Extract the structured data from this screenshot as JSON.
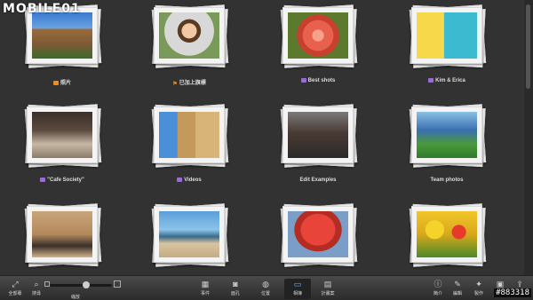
{
  "logo": "MOBILE01",
  "albums": [
    {
      "label": "照片",
      "icon": "photos-icon",
      "icon_color": "orange"
    },
    {
      "label": "已加上旗標",
      "icon": "flag-icon",
      "icon_color": "flag"
    },
    {
      "label": "Best shots",
      "icon": "album-icon",
      "icon_color": "purple"
    },
    {
      "label": "Kim & Erica",
      "icon": "album-icon",
      "icon_color": "purple"
    },
    {
      "label": "\"Cafe Society\"",
      "icon": "album-icon",
      "icon_color": "purple"
    },
    {
      "label": "Videos",
      "icon": "album-icon",
      "icon_color": "purple"
    },
    {
      "label": "Edit Examples",
      "icon": "",
      "icon_color": ""
    },
    {
      "label": "Team photos",
      "icon": "",
      "icon_color": ""
    },
    {
      "label": "",
      "icon": "",
      "icon_color": ""
    },
    {
      "label": "",
      "icon": "",
      "icon_color": ""
    },
    {
      "label": "",
      "icon": "",
      "icon_color": ""
    },
    {
      "label": "",
      "icon": "",
      "icon_color": ""
    }
  ],
  "toolbar": {
    "show_all": "全部專",
    "search": "搜尋",
    "zoom": "縮放",
    "events": "事件",
    "faces": "面孔",
    "places": "位置",
    "albums": "相簿",
    "projects": "計畫案",
    "info": "簡介",
    "edit": "編輯",
    "effects": "製作",
    "share": "分享"
  },
  "zoom_level": 0.6,
  "watermark": "#883318"
}
